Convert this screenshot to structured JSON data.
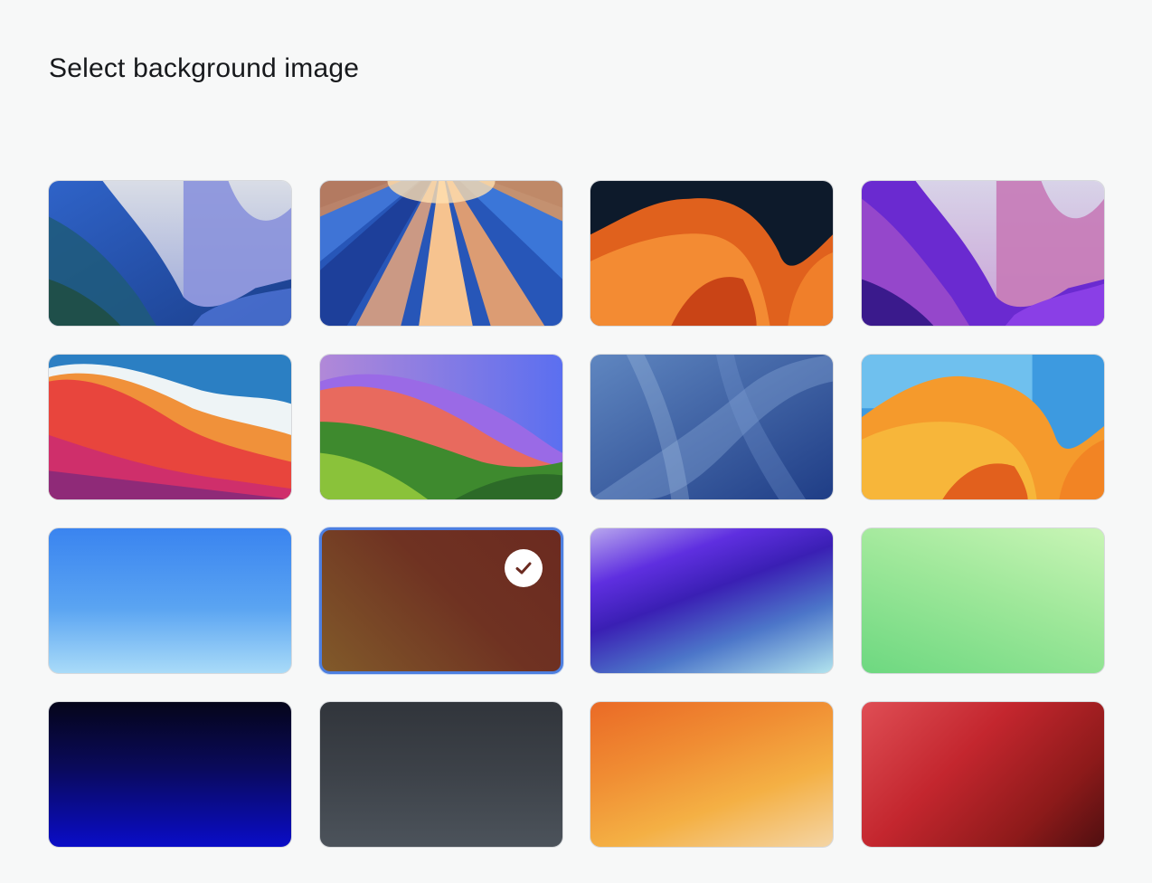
{
  "heading": "Select background image",
  "wallpapers": [
    {
      "name": "sequoia-blue",
      "style": "landscape",
      "selected": false
    },
    {
      "name": "sunrise-rays",
      "style": "landscape",
      "selected": false
    },
    {
      "name": "ventura-dark",
      "style": "landscape",
      "selected": false
    },
    {
      "name": "monterey-purple",
      "style": "landscape",
      "selected": false
    },
    {
      "name": "big-sur-red",
      "style": "landscape",
      "selected": false
    },
    {
      "name": "sonoma-hills",
      "style": "landscape",
      "selected": false
    },
    {
      "name": "blue-waves",
      "style": "landscape",
      "selected": false
    },
    {
      "name": "ventura-light",
      "style": "landscape",
      "selected": false
    },
    {
      "name": "sky-blue",
      "style": "gradient",
      "colors": [
        "#3a84f0",
        "#a9dbf8"
      ],
      "selected": false
    },
    {
      "name": "brown",
      "style": "gradient",
      "colors": [
        "#6b2a20",
        "#815a2a"
      ],
      "selected": true
    },
    {
      "name": "violet",
      "style": "gradient",
      "colors": [
        "#5f2fe0",
        "#b2e4ee"
      ],
      "selected": false
    },
    {
      "name": "mint-green",
      "style": "gradient",
      "colors": [
        "#c9f5b6",
        "#6dd880"
      ],
      "selected": false
    },
    {
      "name": "midnight-blue",
      "style": "gradient",
      "colors": [
        "#05051a",
        "#0a0dc8"
      ],
      "selected": false
    },
    {
      "name": "slate-gray",
      "style": "gradient",
      "colors": [
        "#31353b",
        "#4c535b"
      ],
      "selected": false
    },
    {
      "name": "sunset-orange",
      "style": "gradient",
      "colors": [
        "#ea6a26",
        "#f4d5a5"
      ],
      "selected": false
    },
    {
      "name": "crimson",
      "style": "gradient",
      "colors": [
        "#df4e55",
        "#4f0f10"
      ],
      "selected": false
    }
  ],
  "colors": {
    "selection_border": "#4d7fe0",
    "background": "#f7f8f8",
    "checkmark": "#6b2a20"
  },
  "icons": {
    "selected_indicator": "checkmark-icon"
  }
}
